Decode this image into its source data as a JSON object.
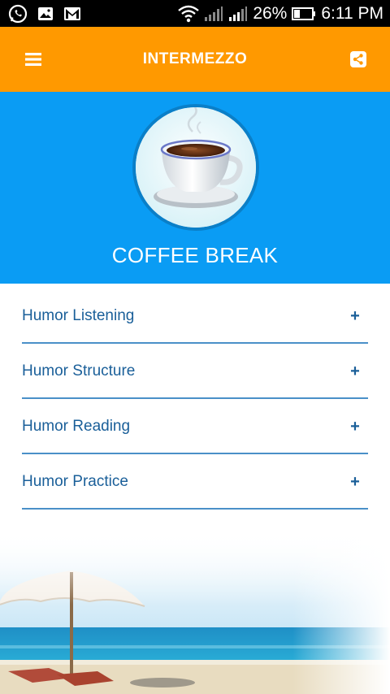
{
  "status_bar": {
    "battery": "26%",
    "time": "6:11 PM",
    "icons": [
      "whatsapp-icon",
      "image-icon",
      "gmail-icon",
      "wifi-icon",
      "signal-icon",
      "signal-icon",
      "battery-icon"
    ]
  },
  "app_bar": {
    "title": "INTERMEZZO",
    "menu_icon": "hamburger-menu-icon",
    "share_icon": "share-icon",
    "background": "#ff9900"
  },
  "hero": {
    "title": "COFFEE BREAK",
    "background": "#0a9cf4"
  },
  "menu": {
    "items": [
      {
        "label": "Humor Listening",
        "expand": "+"
      },
      {
        "label": "Humor Structure",
        "expand": "+"
      },
      {
        "label": "Humor Reading",
        "expand": "+"
      },
      {
        "label": "Humor Practice",
        "expand": "+"
      }
    ],
    "text_color": "#1a5f99"
  }
}
